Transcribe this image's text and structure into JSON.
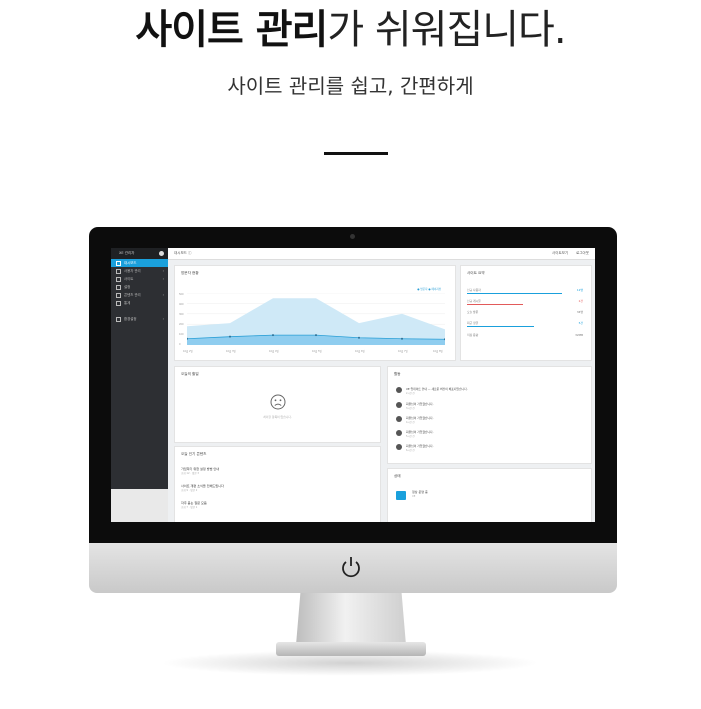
{
  "headline": {
    "bold": "사이트 관리",
    "rest": "가 쉬워집니다."
  },
  "subtitle": "사이트 관리를 쉽고, 간편하게",
  "screen": {
    "sidebar": {
      "title": "XE 관리자",
      "items": [
        {
          "label": "대시보드",
          "active": true
        },
        {
          "label": "사용자 관리"
        },
        {
          "label": "사이트"
        },
        {
          "label": "설정"
        },
        {
          "label": "콘텐츠 관리"
        },
        {
          "label": "통계"
        },
        {
          "label": "환경설정"
        }
      ]
    },
    "topbar": {
      "breadcrumb": "대시보드 ⓘ",
      "links": [
        "사이트보기",
        "로그아웃"
      ]
    },
    "visitor_card": {
      "title": "방문자 현황",
      "legend": "● 방문자  ● 페이지뷰",
      "y_labels": [
        "500",
        "400",
        "300",
        "200",
        "100",
        "0"
      ],
      "x_labels": [
        "10월 2일",
        "10월 3일",
        "10월 4일",
        "10월 5일",
        "10월 6일",
        "10월 7일",
        "10월 8일"
      ]
    },
    "chart_data": {
      "type": "area",
      "categories": [
        "10월 2일",
        "10월 3일",
        "10월 4일",
        "10월 5일",
        "10월 6일",
        "10월 7일",
        "10월 8일"
      ],
      "series": [
        {
          "name": "방문자",
          "values": [
            180,
            210,
            450,
            450,
            210,
            300,
            150
          ]
        },
        {
          "name": "페이지뷰",
          "values": [
            60,
            80,
            95,
            95,
            70,
            60,
            55
          ]
        }
      ],
      "ylim": [
        0,
        500
      ],
      "grid": true,
      "legend_position": "top-right",
      "colors": {
        "visitor": "#cfe9f7",
        "pageview": "#8fcdef",
        "line": "#2a9fd6"
      }
    },
    "site_status": {
      "title": "사이트 요약",
      "rows": [
        {
          "label": "신규 사용자",
          "value": "12명",
          "bar": 0.82,
          "color": "#1aa0dc"
        },
        {
          "label": "신규 게시물",
          "value": "2건",
          "bar": 0.48,
          "color": "#e25a5a"
        },
        {
          "label": "오늘 방문",
          "value": "34명"
        },
        {
          "label": "최근 댓글",
          "value": "5건",
          "bar": 0.58,
          "color": "#1aa0dc"
        },
        {
          "label": "저장 용량",
          "value": "32MB"
        }
      ]
    },
    "today_card": {
      "title": "오늘의 할일",
      "empty": "처리할 항목이 없습니다."
    },
    "activity_card": {
      "title": "활동",
      "items": [
        {
          "text": "XE 업데이트 안내 — 새로운 버전이 배포되었습니다.",
          "sub": "2시간 전"
        },
        {
          "text": "회원님이 가입했습니다.",
          "sub": "3시간 전"
        },
        {
          "text": "회원님이 가입했습니다.",
          "sub": "4시간 전"
        },
        {
          "text": "회원님이 가입했습니다.",
          "sub": "5시간 전"
        },
        {
          "text": "회원님이 가입했습니다.",
          "sub": "6시간 전"
        }
      ]
    },
    "popular_card": {
      "title": "오늘 인기 콘텐츠",
      "items": [
        {
          "title": "가입하기 위한 설정 방법 안내",
          "meta": "조회 12 · 댓글 3"
        },
        {
          "title": "사이트 개편 소식을 전해드립니다",
          "meta": "조회 9 · 댓글 2"
        },
        {
          "title": "자주 묻는 질문 모음",
          "meta": "조회 7 · 댓글 1"
        }
      ]
    },
    "status_card": {
      "title": "상태",
      "line1": "정상 운영 중",
      "line2": "XE"
    }
  }
}
